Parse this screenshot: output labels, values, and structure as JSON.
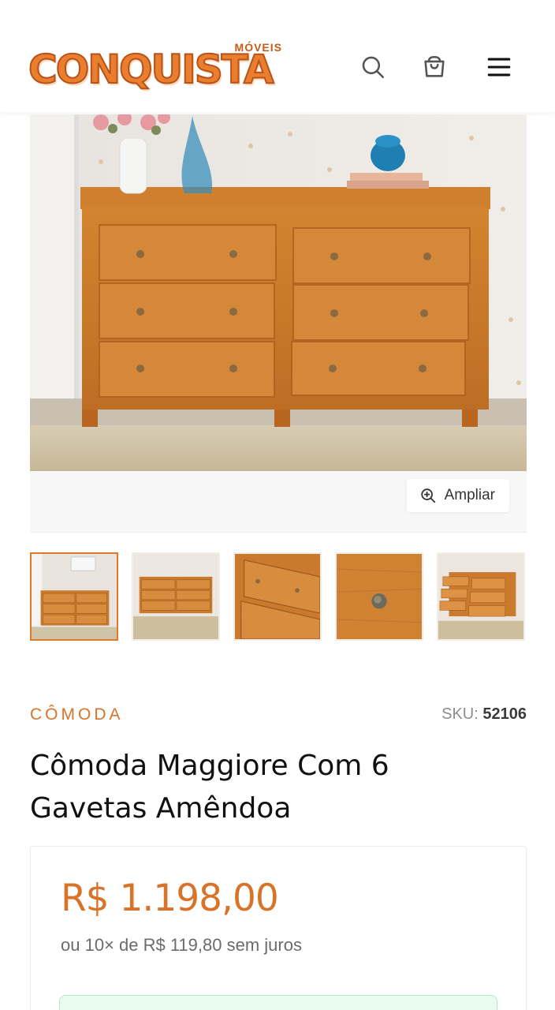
{
  "header": {
    "brand_main": "CONQUISTA",
    "brand_sub": "MÓVEIS",
    "search_icon": "search-icon",
    "cart_icon": "cart-icon",
    "menu_icon": "menu-icon"
  },
  "gallery": {
    "zoom_label": "Ampliar",
    "thumbnails": [
      "thumb-1",
      "thumb-2",
      "thumb-3",
      "thumb-4",
      "thumb-5"
    ],
    "active_thumbnail": 1
  },
  "product": {
    "category": "CÔMODA",
    "sku_label": "SKU:",
    "sku_value": "52106",
    "title": "Cômoda Maggiore Com 6 Gavetas Amêndoa",
    "price": "R$ 1.198,00",
    "installments": "ou 10× de R$ 119,80 sem juros"
  },
  "colors": {
    "accent": "#d8732a",
    "wood": "#c9782b",
    "pix_bg": "#eafbef"
  }
}
